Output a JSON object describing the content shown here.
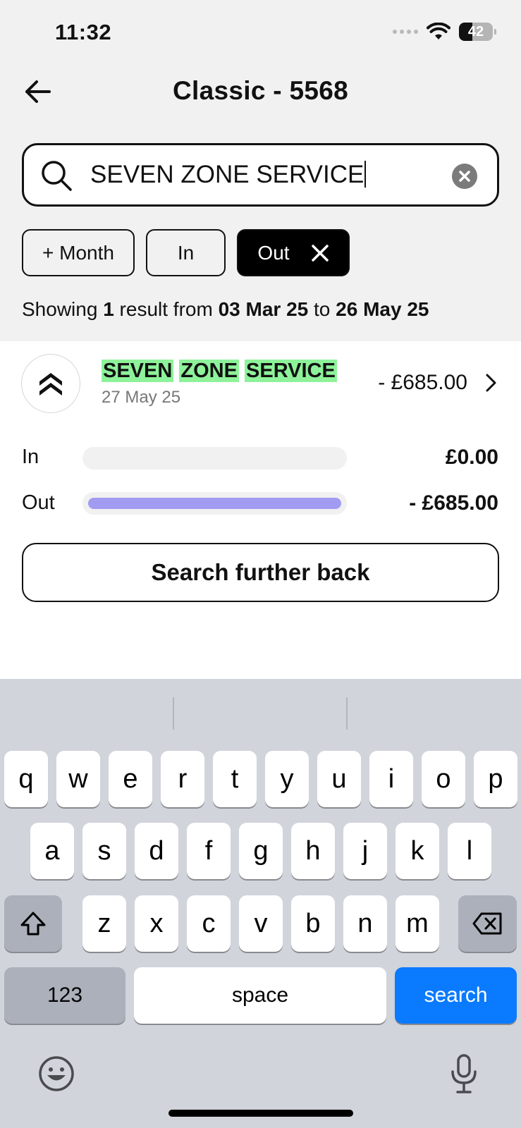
{
  "status_bar": {
    "time": "11:32",
    "battery": "42"
  },
  "header": {
    "title": "Classic - 5568"
  },
  "search": {
    "value": "SEVEN ZONE SERVICE"
  },
  "filters": {
    "month": "+ Month",
    "in": "In",
    "out": "Out"
  },
  "summary": {
    "prefix": "Showing",
    "count": "1",
    "middle": "result from",
    "start_date": "03 Mar 25",
    "to": "to",
    "end_date": "26 May 25"
  },
  "transaction": {
    "name_words": [
      "SEVEN",
      "ZONE",
      "SERVICE"
    ],
    "date": "27 May 25",
    "amount": "- £685.00",
    "highlight_color": "#8ef29a"
  },
  "flows": {
    "in_label": "In",
    "in_value": "£0.00",
    "in_fraction": 0,
    "out_label": "Out",
    "out_value": "- £685.00",
    "out_fraction": 1,
    "bar_color": "#a29bf2"
  },
  "search_further_back": "Search further back",
  "keyboard": {
    "row1": [
      "q",
      "w",
      "e",
      "r",
      "t",
      "y",
      "u",
      "i",
      "o",
      "p"
    ],
    "row2": [
      "a",
      "s",
      "d",
      "f",
      "g",
      "h",
      "j",
      "k",
      "l"
    ],
    "row3": [
      "z",
      "x",
      "c",
      "v",
      "b",
      "n",
      "m"
    ],
    "numbers": "123",
    "space": "space",
    "action": "search",
    "action_color": "#0a7aff"
  }
}
